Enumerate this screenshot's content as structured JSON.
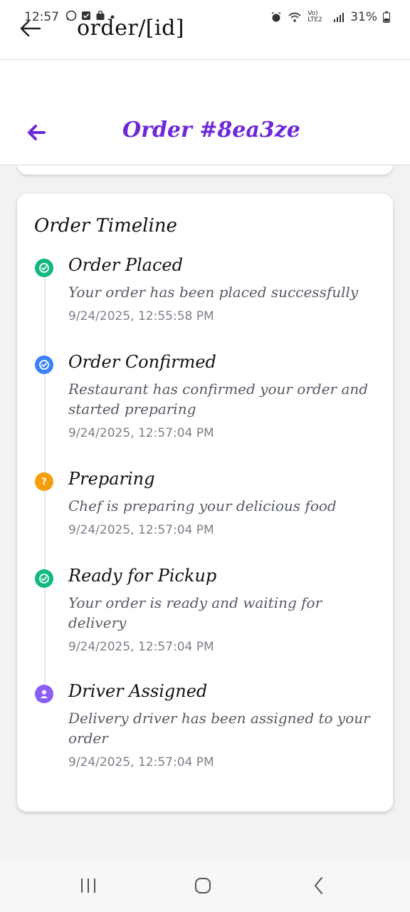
{
  "status_bar": {
    "time": "12:57",
    "battery": "31%",
    "network": "Vo) LTE2"
  },
  "browser": {
    "url_title": "order/[id]"
  },
  "header": {
    "title": "Order #8ea3ze"
  },
  "timeline": {
    "heading": "Order Timeline",
    "items": [
      {
        "title": "Order Placed",
        "description": "Your order has been placed successfully",
        "timestamp": "9/24/2025, 12:55:58 PM",
        "icon": "check-circle-icon",
        "color": "#10b981"
      },
      {
        "title": "Order Confirmed",
        "description": "Restaurant has confirmed your order and started preparing",
        "timestamp": "9/24/2025, 12:57:04 PM",
        "icon": "check-circle-icon",
        "color": "#3b82f6"
      },
      {
        "title": "Preparing",
        "description": "Chef is preparing your delicious food",
        "timestamp": "9/24/2025, 12:57:04 PM",
        "icon": "question-circle-icon",
        "color": "#f59e0b"
      },
      {
        "title": "Ready for Pickup",
        "description": "Your order is ready and waiting for delivery",
        "timestamp": "9/24/2025, 12:57:04 PM",
        "icon": "check-circle-icon",
        "color": "#10b981"
      },
      {
        "title": "Driver Assigned",
        "description": "Delivery driver has been assigned to your order",
        "timestamp": "9/24/2025, 12:57:04 PM",
        "icon": "person-circle-icon",
        "color": "#8b5cf6"
      }
    ]
  },
  "colors": {
    "accent": "#6d28d9",
    "background": "#f1f2f4"
  }
}
